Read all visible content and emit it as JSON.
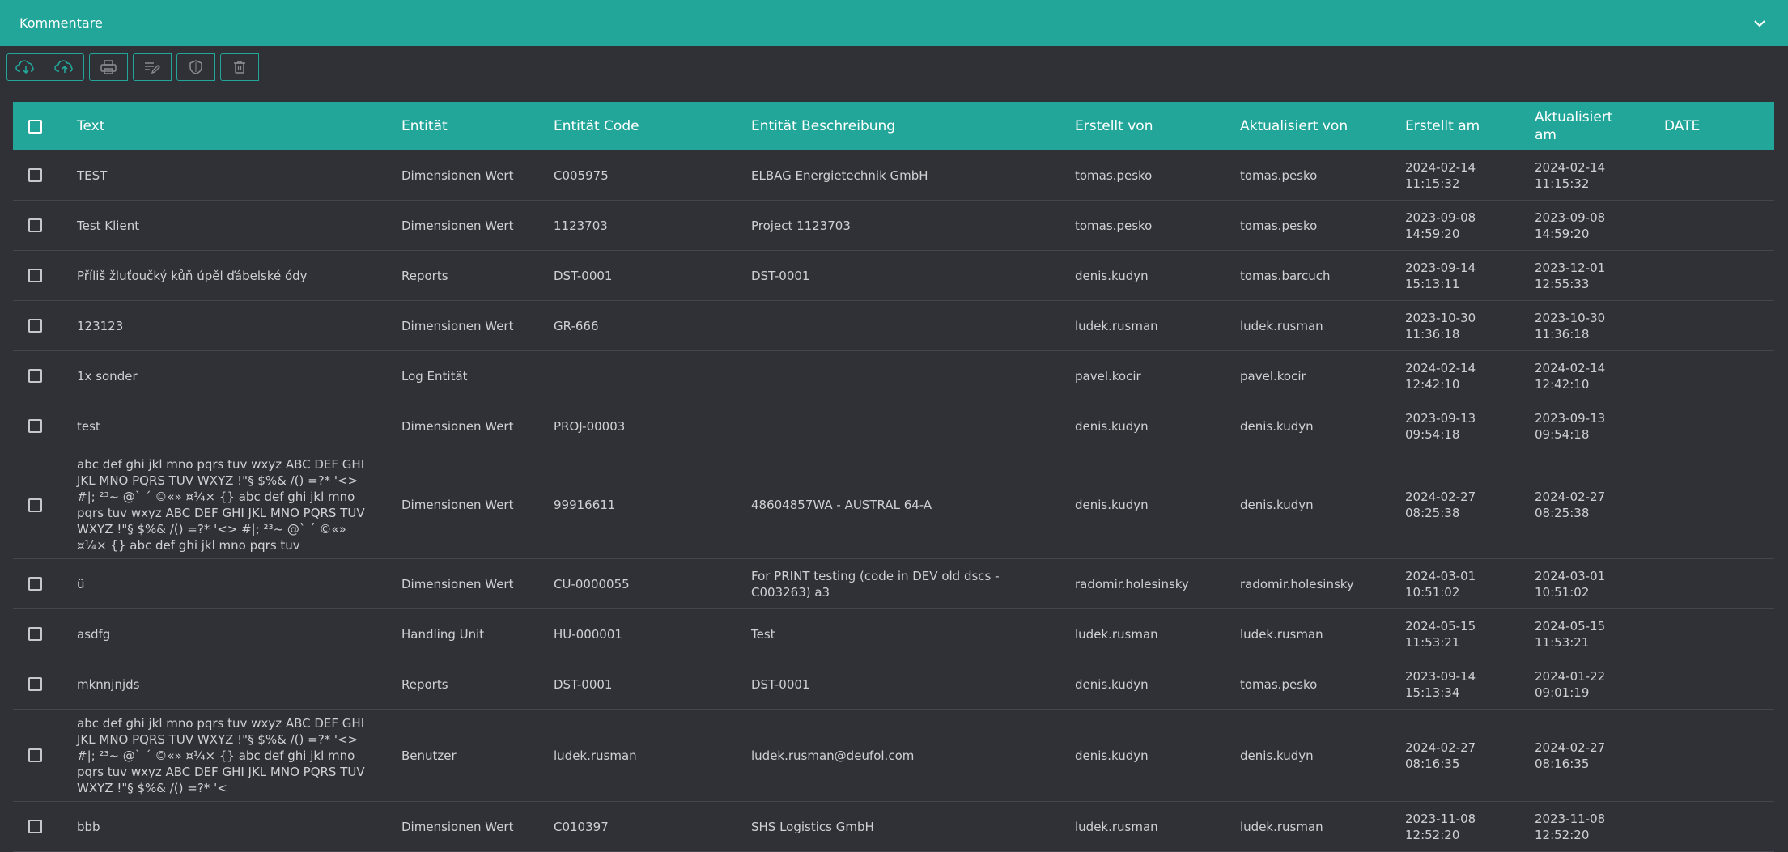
{
  "panel": {
    "title": "Kommentare",
    "collapse_icon": "chevron-down-icon"
  },
  "toolbar": {
    "icons": [
      "cloud-download-icon",
      "cloud-upload-icon",
      "printer-icon",
      "edit-list-icon",
      "shield-icon",
      "trash-icon"
    ]
  },
  "colors": {
    "accent": "#23a69a",
    "background": "#2f3136",
    "row_divider": "#43464c"
  },
  "table": {
    "columns": {
      "text": "Text",
      "entity": "Entität",
      "entity_code": "Entität Code",
      "entity_description": "Entität Beschreibung",
      "created_by": "Erstellt von",
      "updated_by": "Aktualisiert von",
      "created_at": "Erstellt am",
      "updated_at": "Aktualisiert am",
      "date": "DATE"
    },
    "rows": [
      {
        "text": "TEST",
        "entity": "Dimensionen Wert",
        "code": "C005975",
        "desc": "ELBAG Energietechnik GmbH",
        "created_by": "tomas.pesko",
        "updated_by": "tomas.pesko",
        "created_at": "2024-02-14 11:15:32",
        "updated_at": "2024-02-14 11:15:32",
        "date": ""
      },
      {
        "text": "Test Klient",
        "entity": "Dimensionen Wert",
        "code": "1123703",
        "desc": "Project 1123703",
        "created_by": "tomas.pesko",
        "updated_by": "tomas.pesko",
        "created_at": "2023-09-08 14:59:20",
        "updated_at": "2023-09-08 14:59:20",
        "date": ""
      },
      {
        "text": "Příliš žluťoučký kůň úpěl ďábelské ódy",
        "entity": "Reports",
        "code": "DST-0001",
        "desc": "DST-0001",
        "created_by": "denis.kudyn",
        "updated_by": "tomas.barcuch",
        "created_at": "2023-09-14 15:13:11",
        "updated_at": "2023-12-01 12:55:33",
        "date": ""
      },
      {
        "text": "123123",
        "entity": "Dimensionen Wert",
        "code": "GR-666",
        "desc": "",
        "created_by": "ludek.rusman",
        "updated_by": "ludek.rusman",
        "created_at": "2023-10-30 11:36:18",
        "updated_at": "2023-10-30 11:36:18",
        "date": ""
      },
      {
        "text": "1x sonder",
        "entity": "Log Entität",
        "code": "",
        "desc": "",
        "created_by": "pavel.kocir",
        "updated_by": "pavel.kocir",
        "created_at": "2024-02-14 12:42:10",
        "updated_at": "2024-02-14 12:42:10",
        "date": ""
      },
      {
        "text": "test",
        "entity": "Dimensionen Wert",
        "code": "PROJ-00003",
        "desc": "",
        "created_by": "denis.kudyn",
        "updated_by": "denis.kudyn",
        "created_at": "2023-09-13 09:54:18",
        "updated_at": "2023-09-13 09:54:18",
        "date": ""
      },
      {
        "text": "abc def ghi jkl mno pqrs tuv wxyz ABC DEF GHI JKL MNO PQRS TUV WXYZ !\"§ $%& /() =?* '<> #|; ²³~ @` ´ ©«» ¤¼× {} abc def ghi jkl mno pqrs tuv wxyz ABC DEF GHI JKL MNO PQRS TUV WXYZ !\"§ $%& /() =?* '<> #|; ²³~ @` ´ ©«» ¤¼× {} abc def ghi jkl mno pqrs tuv",
        "entity": "Dimensionen Wert",
        "code": "99916611",
        "desc": "48604857WA - AUSTRAL 64-A",
        "created_by": "denis.kudyn",
        "updated_by": "denis.kudyn",
        "created_at": "2024-02-27 08:25:38",
        "updated_at": "2024-02-27 08:25:38",
        "date": ""
      },
      {
        "text": "ü",
        "entity": "Dimensionen Wert",
        "code": "CU-0000055",
        "desc": "For PRINT testing (code in DEV old dscs - C003263) a3",
        "created_by": "radomir.holesinsky",
        "updated_by": "radomir.holesinsky",
        "created_at": "2024-03-01 10:51:02",
        "updated_at": "2024-03-01 10:51:02",
        "date": ""
      },
      {
        "text": "asdfg",
        "entity": "Handling Unit",
        "code": "HU-000001",
        "desc": "Test",
        "created_by": "ludek.rusman",
        "updated_by": "ludek.rusman",
        "created_at": "2024-05-15 11:53:21",
        "updated_at": "2024-05-15 11:53:21",
        "date": ""
      },
      {
        "text": "mknnjnjds",
        "entity": "Reports",
        "code": "DST-0001",
        "desc": "DST-0001",
        "created_by": "denis.kudyn",
        "updated_by": "tomas.pesko",
        "created_at": "2023-09-14 15:13:34",
        "updated_at": "2024-01-22 09:01:19",
        "date": ""
      },
      {
        "text": "abc def ghi jkl mno pqrs tuv wxyz ABC DEF GHI JKL MNO PQRS TUV WXYZ !\"§ $%& /() =?* '<> #|; ²³~ @` ´ ©«» ¤¼× {} abc def ghi jkl mno pqrs tuv wxyz ABC DEF GHI JKL MNO PQRS TUV WXYZ !\"§ $%& /() =?* '<",
        "entity": "Benutzer",
        "code": "ludek.rusman",
        "desc": "ludek.rusman@deufol.com",
        "created_by": "denis.kudyn",
        "updated_by": "denis.kudyn",
        "created_at": "2024-02-27 08:16:35",
        "updated_at": "2024-02-27 08:16:35",
        "date": ""
      },
      {
        "text": "bbb",
        "entity": "Dimensionen Wert",
        "code": "C010397",
        "desc": "SHS Logistics GmbH",
        "created_by": "ludek.rusman",
        "updated_by": "ludek.rusman",
        "created_at": "2023-11-08 12:52:20",
        "updated_at": "2023-11-08 12:52:20",
        "date": ""
      }
    ]
  }
}
